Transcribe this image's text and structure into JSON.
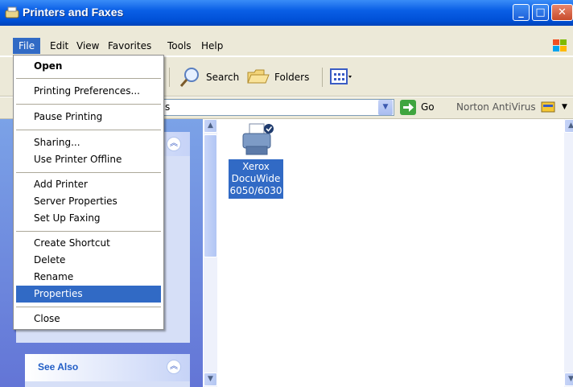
{
  "window": {
    "title": "Printers and Faxes"
  },
  "menubar": {
    "items": [
      "File",
      "Edit",
      "View",
      "Favorites",
      "Tools",
      "Help"
    ]
  },
  "toolbar": {
    "search_label": "Search",
    "folders_label": "Folders"
  },
  "addressbar": {
    "value_fragment": "s",
    "go_label": "Go",
    "norton_label": "Norton AntiVirus"
  },
  "file_menu": {
    "items": [
      {
        "label": "Open",
        "bold": true
      },
      {
        "label": "Printing Preferences..."
      },
      {
        "label": "Pause Printing"
      },
      {
        "label": "Sharing..."
      },
      {
        "label": "Use Printer Offline"
      },
      {
        "label": "Add Printer"
      },
      {
        "label": "Server Properties"
      },
      {
        "label": "Set Up Faxing"
      },
      {
        "label": "Create Shortcut"
      },
      {
        "label": "Delete"
      },
      {
        "label": "Rename"
      },
      {
        "label": "Properties",
        "selected": true
      },
      {
        "label": "Close"
      }
    ]
  },
  "taskpane": {
    "see_also": "See Also"
  },
  "content": {
    "printer_label_lines": [
      "Xerox",
      "DocuWide",
      "6050/6030"
    ]
  },
  "colors": {
    "selection": "#316ac5",
    "titlebar": "#0a5fe6",
    "taskpane": "#7ba2e7"
  }
}
